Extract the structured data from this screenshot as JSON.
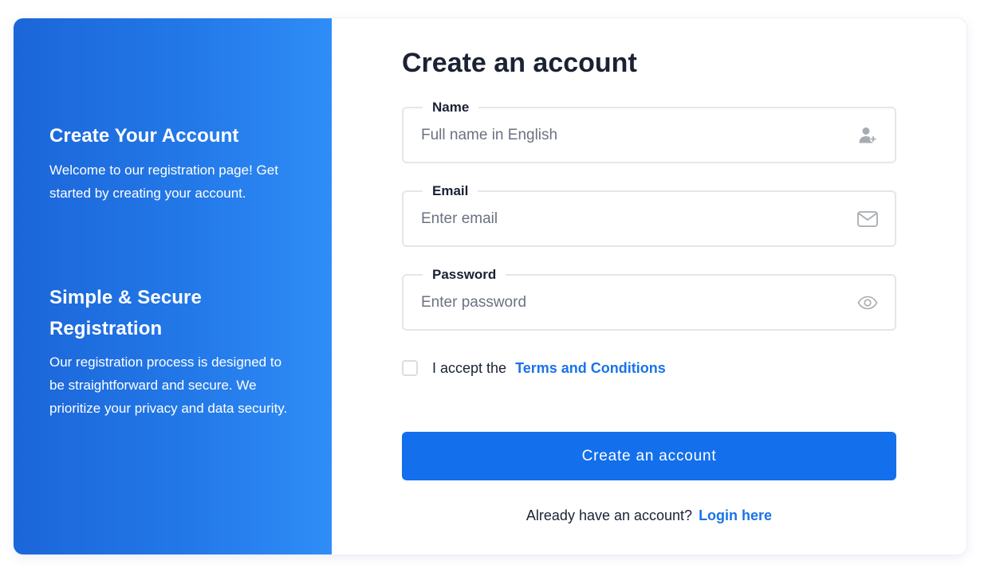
{
  "left_panel": {
    "section1": {
      "title": "Create Your Account",
      "text": "Welcome to our registration page! Get started by creating your account."
    },
    "section2": {
      "title": "Simple & Secure Registration",
      "text": "Our registration process is designed to be straightforward and secure. We prioritize your privacy and data security."
    }
  },
  "form": {
    "title": "Create an account",
    "fields": {
      "name": {
        "label": "Name",
        "value": "",
        "placeholder": "Full name in English",
        "icon": "user-add-icon"
      },
      "email": {
        "label": "Email",
        "value": "",
        "placeholder": "Enter email",
        "icon": "envelope-icon"
      },
      "password": {
        "label": "Password",
        "value": "",
        "placeholder": "Enter password",
        "icon": "eye-icon"
      }
    },
    "terms": {
      "text": "I accept the",
      "link": "Terms and Conditions",
      "checked": false
    },
    "submit_label": "Create an account",
    "login": {
      "text": "Already have an account?",
      "link": "Login here"
    }
  },
  "colors": {
    "gradient_start": "#1b66d9",
    "gradient_end": "#2f8df7",
    "primary_button": "#136fec",
    "link": "#1a73e8",
    "text_dark": "#1a2233",
    "placeholder": "#6b7280",
    "border": "#e4e6ea",
    "icon_gray": "#a8abb1"
  }
}
